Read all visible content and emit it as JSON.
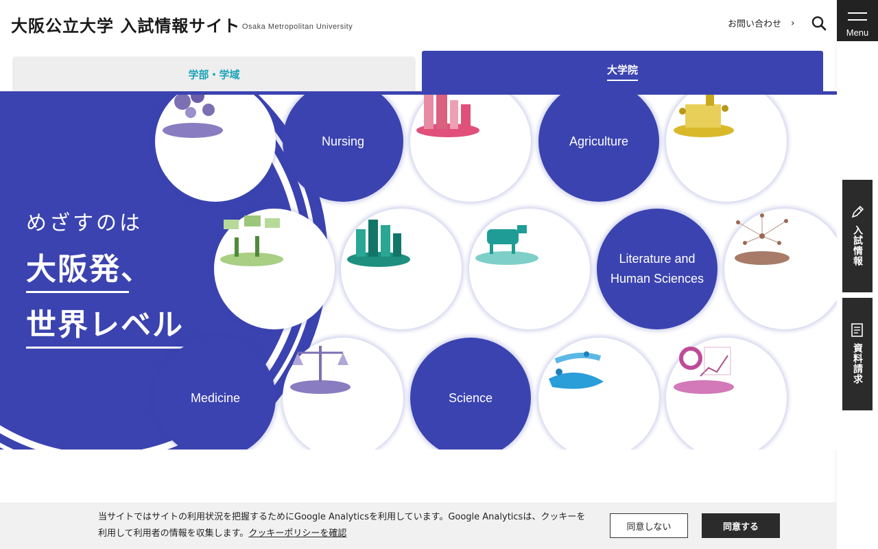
{
  "header": {
    "title": "大阪公立大学 入試情報サイト",
    "subtitle": "Osaka Metropolitan University",
    "contact_label": "お問い合わせ",
    "search_icon": "search-icon",
    "menu_label": "Menu"
  },
  "tabs": [
    {
      "label": "学部・学域",
      "active": false
    },
    {
      "label": "大学院",
      "active": true
    }
  ],
  "side_tabs": [
    {
      "label": "入試情報",
      "icon": "pencil-icon"
    },
    {
      "label": "資料請求",
      "icon": "document-icon"
    }
  ],
  "hero": {
    "line1": "めざすのは",
    "line2": "大阪発、",
    "line3": "世界レベル"
  },
  "circles": [
    {
      "kind": "image",
      "icon": "gears-illustration",
      "color": "#7d6fb3"
    },
    {
      "kind": "label",
      "label": "Nursing"
    },
    {
      "kind": "image",
      "icon": "city-buildings-illustration",
      "color": "#e0507a"
    },
    {
      "kind": "label",
      "label": "Agriculture"
    },
    {
      "kind": "image",
      "icon": "factory-people-illustration",
      "color": "#d9b92a"
    },
    {
      "kind": "image",
      "icon": "park-people-illustration",
      "color": "#7fb55a"
    },
    {
      "kind": "image",
      "icon": "green-city-illustration",
      "color": "#1f8f7f"
    },
    {
      "kind": "image",
      "icon": "cow-animals-illustration",
      "color": "#2aa6a0"
    },
    {
      "kind": "label",
      "label": "Literature and Human Sciences"
    },
    {
      "kind": "image",
      "icon": "network-illustration",
      "color": "#9a6a55"
    },
    {
      "kind": "label",
      "label": "Medicine"
    },
    {
      "kind": "image",
      "icon": "scales-of-justice-illustration",
      "color": "#7d6fb3"
    },
    {
      "kind": "label",
      "label": "Science"
    },
    {
      "kind": "image",
      "icon": "wheelchair-sports-illustration",
      "color": "#1f8fd0"
    },
    {
      "kind": "image",
      "icon": "chart-gear-illustration",
      "color": "#c04a9a"
    }
  ],
  "cookie": {
    "text_part1": "当サイトではサイトの利用状況を把握するためにGoogle Analyticsを利用しています。Google Analyticsは、クッキーを利用して利用者の情報を収集します。",
    "policy_link": "クッキーポリシーを確認",
    "decline_label": "同意しない",
    "accept_label": "同意する"
  },
  "colors": {
    "brand_blue": "#3b43b0",
    "tab_teal_text": "#1aa3b8",
    "dark": "#2b2b2b"
  }
}
